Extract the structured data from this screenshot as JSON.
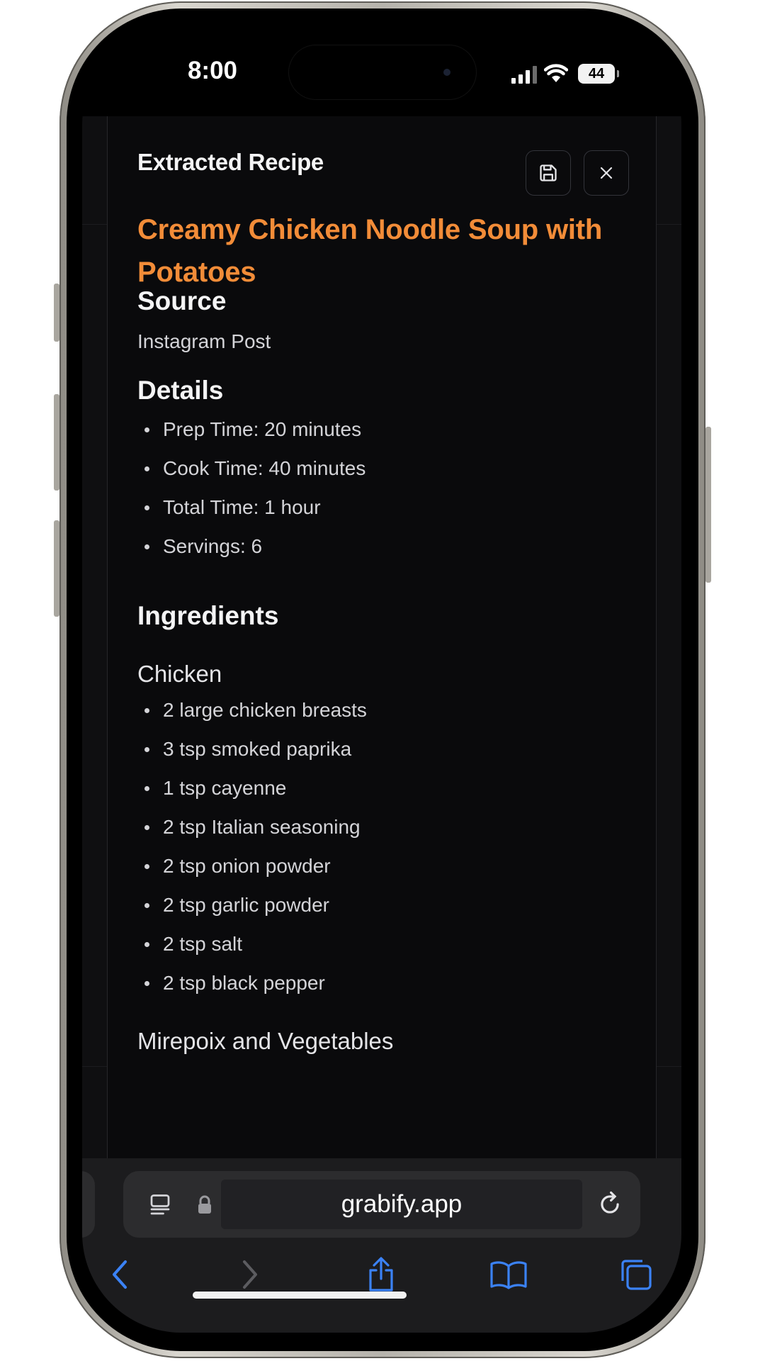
{
  "status_bar": {
    "time": "8:00",
    "battery": "44",
    "icons": [
      "cellular-signal-icon",
      "wifi-icon",
      "battery-icon"
    ]
  },
  "dialog": {
    "title": "Extracted Recipe",
    "actions": [
      "save-icon",
      "close-icon"
    ]
  },
  "recipe": {
    "title": "Creamy Chicken Noodle Soup with Potatoes",
    "source_heading": "Source",
    "source": "Instagram Post",
    "details_heading": "Details",
    "details": [
      "Prep Time: 20 minutes",
      "Cook Time: 40 minutes",
      "Total Time: 1 hour",
      "Servings: 6"
    ],
    "ingredients_heading": "Ingredients",
    "groups": [
      {
        "name": "Chicken",
        "items": [
          "2 large chicken breasts",
          "3 tsp smoked paprika",
          "1 tsp cayenne",
          "2 tsp Italian seasoning",
          "2 tsp onion powder",
          "2 tsp garlic powder",
          "2 tsp salt",
          "2 tsp black pepper"
        ]
      },
      {
        "name": "Mirepoix and Vegetables",
        "items": []
      }
    ]
  },
  "browser": {
    "url": "grabify.app",
    "toolbar": [
      "back-icon",
      "forward-icon",
      "share-icon",
      "bookmarks-icon",
      "tabs-icon"
    ]
  },
  "colors": {
    "accent": "#f28c38",
    "link_blue": "#3b82f6",
    "background": "#0a0a0c"
  }
}
